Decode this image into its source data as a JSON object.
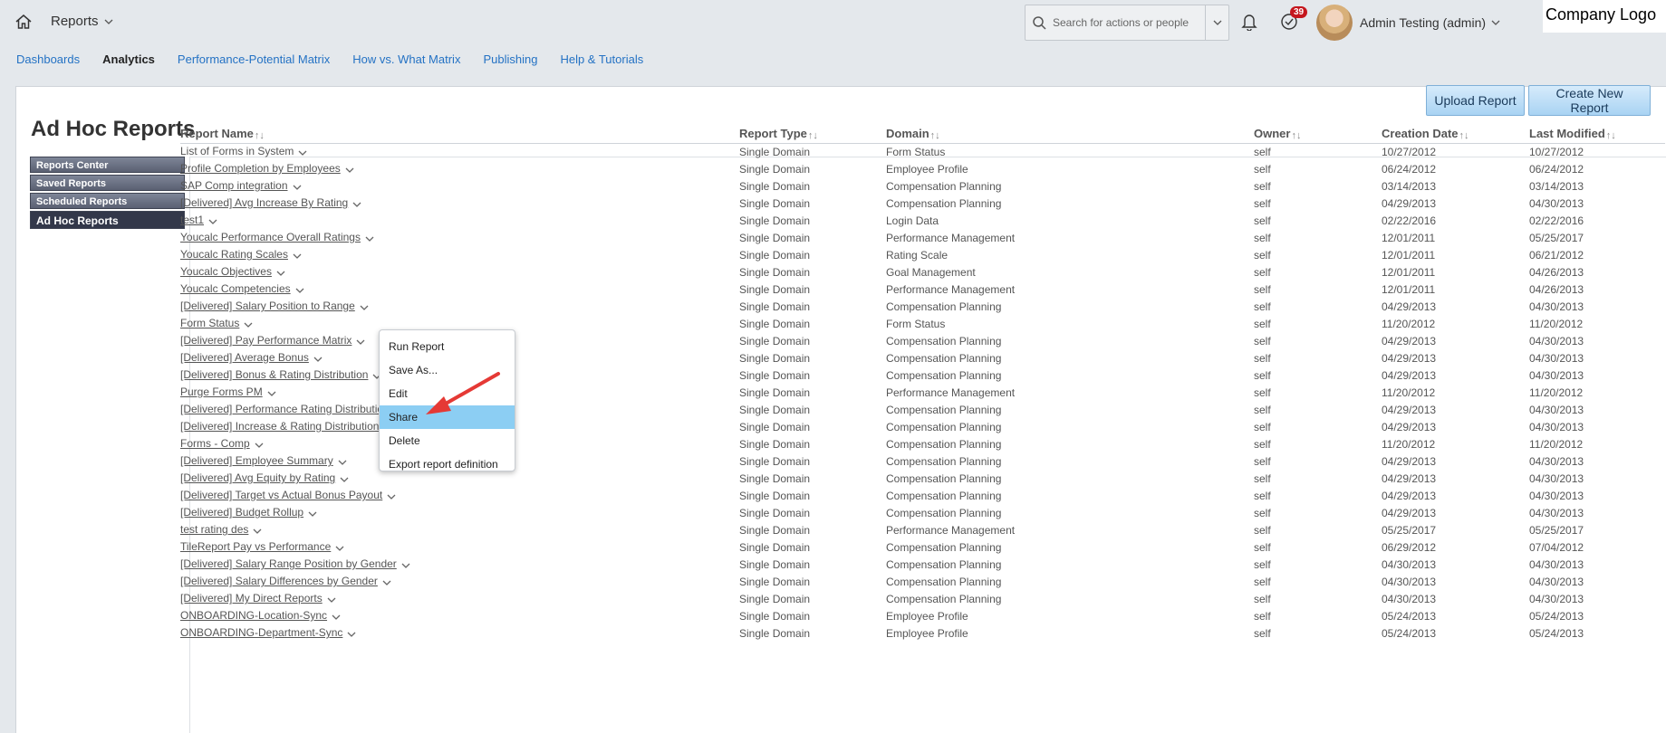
{
  "header": {
    "app_title": "Reports",
    "search_placeholder": "Search for actions or people",
    "notification_count": "39",
    "user_name": "Admin Testing (admin)",
    "company_logo": "Company Logo"
  },
  "nav": [
    "Dashboards",
    "Analytics",
    "Performance-Potential Matrix",
    "How vs. What Matrix",
    "Publishing",
    "Help & Tutorials"
  ],
  "nav_active": "Analytics",
  "page_title": "Ad Hoc Reports",
  "side_menu": [
    "Reports Center",
    "Saved Reports",
    "Scheduled Reports",
    "Ad Hoc Reports"
  ],
  "buttons": {
    "upload": "Upload Report",
    "create": "Create New Report"
  },
  "columns": [
    "Report Name",
    "Report Type",
    "Domain",
    "Owner",
    "Creation Date",
    "Last Modified"
  ],
  "rows": [
    [
      "List of Forms in System",
      "Single Domain",
      "Form Status",
      "self",
      "10/27/2012",
      "10/27/2012",
      false
    ],
    [
      "Profile Completion by Employees",
      "Single Domain",
      "Employee Profile",
      "self",
      "06/24/2012",
      "06/24/2012",
      true
    ],
    [
      "SAP Comp integration",
      "Single Domain",
      "Compensation Planning",
      "self",
      "03/14/2013",
      "03/14/2013",
      true
    ],
    [
      "[Delivered] Avg Increase By Rating",
      "Single Domain",
      "Compensation Planning",
      "self",
      "04/29/2013",
      "04/30/2013",
      true
    ],
    [
      "test1",
      "Single Domain",
      "Login Data",
      "self",
      "02/22/2016",
      "02/22/2016",
      true
    ],
    [
      "Youcalc Performance Overall Ratings",
      "Single Domain",
      "Performance Management",
      "self",
      "12/01/2011",
      "05/25/2017",
      true
    ],
    [
      "Youcalc Rating Scales",
      "Single Domain",
      "Rating Scale",
      "self",
      "12/01/2011",
      "06/21/2012",
      true
    ],
    [
      "Youcalc Objectives",
      "Single Domain",
      "Goal Management",
      "self",
      "12/01/2011",
      "04/26/2013",
      true
    ],
    [
      "Youcalc Competencies",
      "Single Domain",
      "Performance Management",
      "self",
      "12/01/2011",
      "04/26/2013",
      true
    ],
    [
      "[Delivered] Salary Position to Range",
      "Single Domain",
      "Compensation Planning",
      "self",
      "04/29/2013",
      "04/30/2013",
      true
    ],
    [
      "Form Status",
      "Single Domain",
      "Form Status",
      "self",
      "11/20/2012",
      "11/20/2012",
      true
    ],
    [
      "[Delivered] Pay  Performance Matrix",
      "Single Domain",
      "Compensation Planning",
      "self",
      "04/29/2013",
      "04/30/2013",
      true
    ],
    [
      "[Delivered] Average Bonus",
      "Single Domain",
      "Compensation Planning",
      "self",
      "04/29/2013",
      "04/30/2013",
      true
    ],
    [
      "[Delivered] Bonus & Rating Distribution",
      "Single Domain",
      "Compensation Planning",
      "self",
      "04/29/2013",
      "04/30/2013",
      true
    ],
    [
      "Purge Forms PM",
      "Single Domain",
      "Performance Management",
      "self",
      "11/20/2012",
      "11/20/2012",
      true
    ],
    [
      "[Delivered] Performance Rating Distribution",
      "Single Domain",
      "Compensation Planning",
      "self",
      "04/29/2013",
      "04/30/2013",
      true
    ],
    [
      "[Delivered] Increase & Rating Distribution Summary",
      "Single Domain",
      "Compensation Planning",
      "self",
      "04/29/2013",
      "04/30/2013",
      true
    ],
    [
      "Forms - Comp",
      "Single Domain",
      "Compensation Planning",
      "self",
      "11/20/2012",
      "11/20/2012",
      true
    ],
    [
      "[Delivered] Employee Summary",
      "Single Domain",
      "Compensation Planning",
      "self",
      "04/29/2013",
      "04/30/2013",
      true
    ],
    [
      "[Delivered] Avg Equity by Rating",
      "Single Domain",
      "Compensation Planning",
      "self",
      "04/29/2013",
      "04/30/2013",
      true
    ],
    [
      "[Delivered] Target vs Actual Bonus Payout",
      "Single Domain",
      "Compensation Planning",
      "self",
      "04/29/2013",
      "04/30/2013",
      true
    ],
    [
      "[Delivered] Budget Rollup",
      "Single Domain",
      "Compensation Planning",
      "self",
      "04/29/2013",
      "04/30/2013",
      true
    ],
    [
      "test rating des",
      "Single Domain",
      "Performance Management",
      "self",
      "05/25/2017",
      "05/25/2017",
      true
    ],
    [
      "TileReport Pay vs Performance",
      "Single Domain",
      "Compensation Planning",
      "self",
      "06/29/2012",
      "07/04/2012",
      true
    ],
    [
      "[Delivered] Salary Range Position by Gender",
      "Single Domain",
      "Compensation Planning",
      "self",
      "04/30/2013",
      "04/30/2013",
      true
    ],
    [
      "[Delivered] Salary Differences by Gender",
      "Single Domain",
      "Compensation Planning",
      "self",
      "04/30/2013",
      "04/30/2013",
      true
    ],
    [
      "[Delivered] My Direct Reports",
      "Single Domain",
      "Compensation Planning",
      "self",
      "04/30/2013",
      "04/30/2013",
      true
    ],
    [
      "ONBOARDING-Location-Sync",
      "Single Domain",
      "Employee Profile",
      "self",
      "05/24/2013",
      "05/24/2013",
      true
    ],
    [
      "ONBOARDING-Department-Sync",
      "Single Domain",
      "Employee Profile",
      "self",
      "05/24/2013",
      "05/24/2013",
      true
    ]
  ],
  "context_menu": [
    "Run Report",
    "Save As...",
    "Edit",
    "Share",
    "Delete",
    "Export report definition"
  ],
  "context_menu_highlight": "Share",
  "colors": {
    "accent": "#2472c4",
    "highlight": "#8ccef3",
    "badge": "#c5161d",
    "arrow": "#e53935"
  }
}
